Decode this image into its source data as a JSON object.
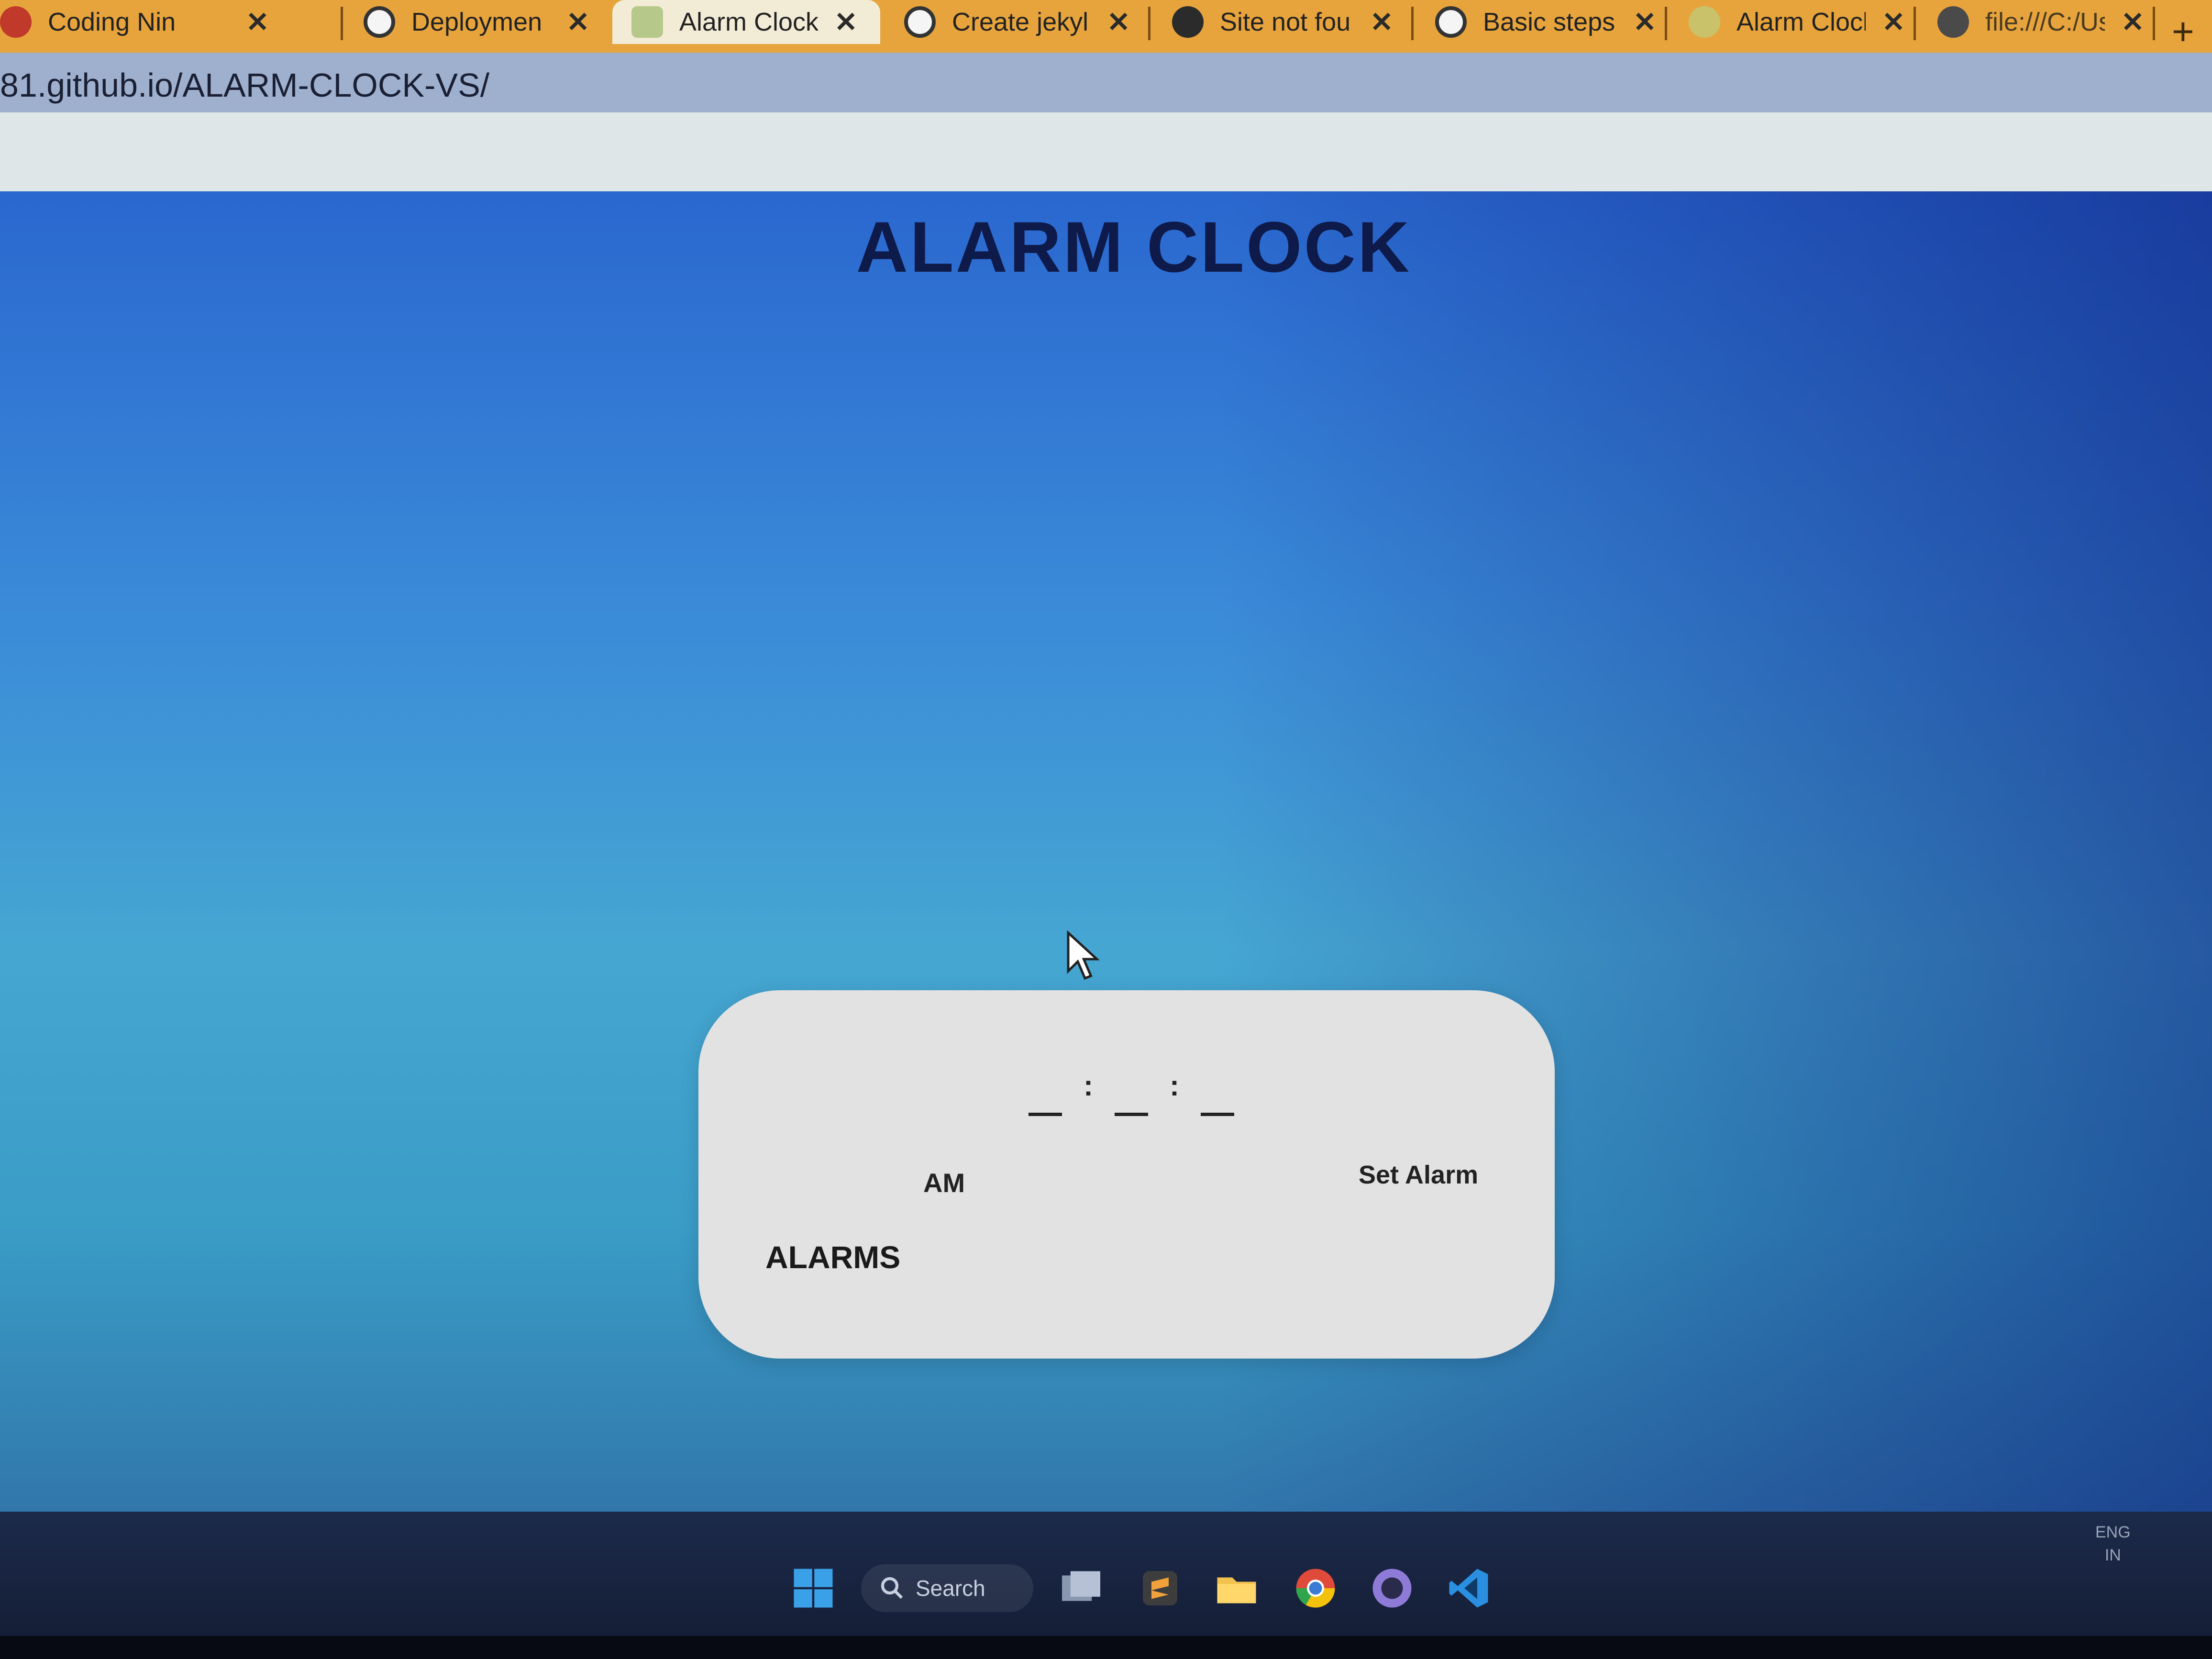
{
  "browser": {
    "tabs": [
      {
        "label": "Coding Nin",
        "icon": "coding-ninjas-icon"
      },
      {
        "label": "Deploymen",
        "icon": "github-icon"
      },
      {
        "label": "Alarm Clock",
        "icon": "alarm-clock-favicon",
        "active": true
      },
      {
        "label": "Create jekyl",
        "icon": "github-icon"
      },
      {
        "label": "Site not fou",
        "icon": "globe-icon"
      },
      {
        "label": "Basic steps",
        "icon": "github-icon"
      },
      {
        "label": "Alarm Clocl",
        "icon": "alarm-clock-favicon"
      },
      {
        "label": "file:///C:/Us",
        "icon": "globe-icon"
      }
    ],
    "new_tab_label": "+",
    "url": "81.github.io/ALARM-CLOCK-VS/"
  },
  "page": {
    "title": "ALARM CLOCK",
    "time_display": {
      "hours": "__",
      "minutes": "__",
      "seconds": "__",
      "separator": ":"
    },
    "ampm": "AM",
    "set_alarm_label": "Set Alarm",
    "alarms_heading": "ALARMS"
  },
  "taskbar": {
    "search_label": "Search",
    "apps": [
      "windows-start-icon",
      "task-view-icon",
      "sublime-text-icon",
      "file-explorer-icon",
      "chrome-icon",
      "github-desktop-icon",
      "vscode-icon"
    ],
    "language": "ENG",
    "region": "IN"
  },
  "colors": {
    "tab_strip": "#e7a43c",
    "page_gradient_top": "#2a67cf",
    "page_gradient_mid": "#46a6d2",
    "title_text": "#0e1a4a",
    "card": "#e2e2e2"
  }
}
